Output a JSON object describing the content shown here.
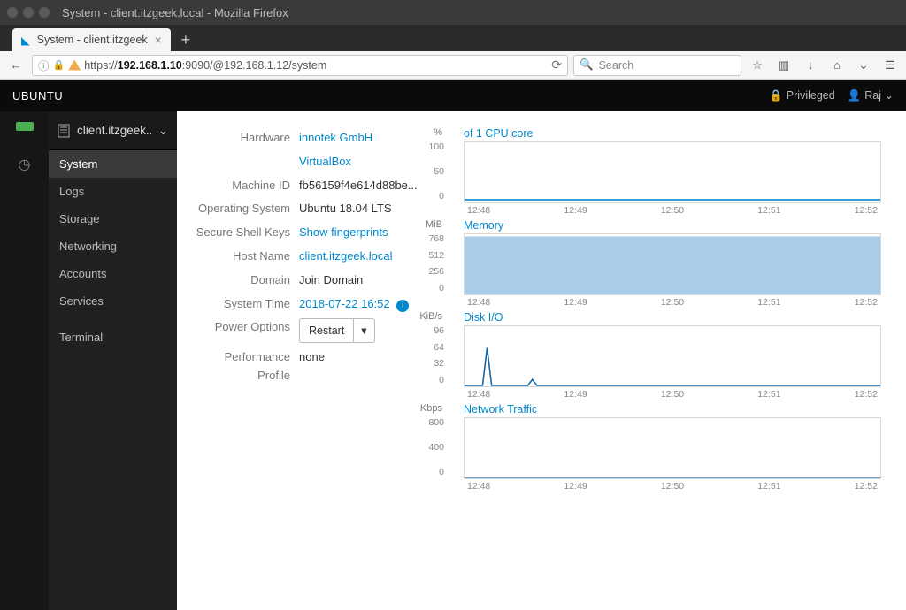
{
  "window": {
    "title": "System - client.itzgeek.local - Mozilla Firefox"
  },
  "tab": {
    "title": "System - client.itzgeek"
  },
  "url": {
    "scheme": "https://",
    "host": "192.168.1.10",
    "rest": ":9090/@192.168.1.12/system"
  },
  "search": {
    "placeholder": "Search"
  },
  "cockpit": {
    "brand": "UBUNTU",
    "privileged": "Privileged",
    "user": "Raj"
  },
  "host_picker": "client.itzgeek....",
  "nav": {
    "system": "System",
    "logs": "Logs",
    "storage": "Storage",
    "networking": "Networking",
    "accounts": "Accounts",
    "services": "Services",
    "terminal": "Terminal"
  },
  "info": {
    "labels": {
      "hardware": "Hardware",
      "machine_id": "Machine ID",
      "os": "Operating System",
      "ssh": "Secure Shell Keys",
      "hostname": "Host Name",
      "domain": "Domain",
      "systime": "System Time",
      "power": "Power Options",
      "perf": "Performance Profile"
    },
    "values": {
      "hardware": "innotek GmbH",
      "virtualbox": "VirtualBox",
      "machine_id": "fb56159f4e614d88be...",
      "os": "Ubuntu 18.04 LTS",
      "ssh": "Show fingerprints",
      "hostname": "client.itzgeek.local",
      "domain": "Join Domain",
      "systime": "2018-07-22 16:52",
      "power": "Restart",
      "perf": "none"
    }
  },
  "charts": {
    "xticks": [
      "12:48",
      "12:49",
      "12:50",
      "12:51",
      "12:52"
    ],
    "cpu": {
      "unit": "%",
      "title": "of 1 CPU core",
      "yticks": [
        "100",
        "50",
        "0"
      ]
    },
    "memory": {
      "unit": "MiB",
      "title": "Memory",
      "yticks": [
        "768",
        "512",
        "256",
        "0"
      ]
    },
    "disk": {
      "unit": "KiB/s",
      "title": "Disk I/O",
      "yticks": [
        "96",
        "64",
        "32",
        "0"
      ]
    },
    "net": {
      "unit": "Kbps",
      "title": "Network Traffic",
      "yticks": [
        "800",
        "400",
        "0"
      ]
    }
  },
  "chart_data": [
    {
      "type": "line",
      "title": "of 1 CPU core",
      "ylabel": "%",
      "ylim": [
        0,
        100
      ],
      "x": [
        "12:48",
        "12:49",
        "12:50",
        "12:51",
        "12:52"
      ],
      "values": [
        3,
        3,
        3,
        3,
        3
      ]
    },
    {
      "type": "area",
      "title": "Memory",
      "ylabel": "MiB",
      "ylim": [
        0,
        800
      ],
      "x": [
        "12:48",
        "12:49",
        "12:50",
        "12:51",
        "12:52"
      ],
      "values": [
        760,
        760,
        760,
        760,
        760
      ]
    },
    {
      "type": "line",
      "title": "Disk I/O",
      "ylabel": "KiB/s",
      "ylim": [
        0,
        96
      ],
      "x": [
        "12:48",
        "12:49",
        "12:50",
        "12:51",
        "12:52"
      ],
      "values": [
        60,
        5,
        0,
        0,
        0
      ]
    },
    {
      "type": "line",
      "title": "Network Traffic",
      "ylabel": "Kbps",
      "ylim": [
        0,
        800
      ],
      "x": [
        "12:48",
        "12:49",
        "12:50",
        "12:51",
        "12:52"
      ],
      "values": [
        5,
        5,
        5,
        5,
        5
      ]
    }
  ]
}
